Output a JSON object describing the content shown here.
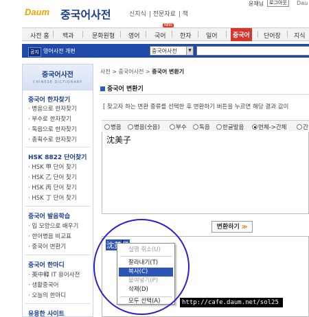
{
  "header": {
    "logo": "Daum",
    "service_title": "중국어사전",
    "sublinks": [
      "신지식",
      "전문자료",
      "책"
    ],
    "user": "윤재님",
    "logout": "로그아웃",
    "right_cut": "Dau"
  },
  "nav": {
    "tabs": [
      "사전 홈",
      "백과",
      "문화원형",
      "영어",
      "국어",
      "한자",
      "일어",
      "중국어",
      "단어장",
      "지식"
    ],
    "active": "중국어",
    "new_badge": "NEW"
  },
  "notice": {
    "badge": "공지",
    "text": "영어사전 개편",
    "search_select": "중국어사전",
    "search_value": ""
  },
  "sidebar": {
    "title": "중국어사전",
    "subtitle": "CHINESE DICTIONARY",
    "sections": [
      {
        "title": "중국어 한자찾기",
        "items": [
          "· 병음으로 한자찾기",
          "· 부수로 한자찾기",
          "· 독음으로 한자찾기",
          "· 총획수로 한자찾기"
        ]
      },
      {
        "title": "HSK 8822 단어찾기",
        "items": [
          "· HSK 甲 단어 찾기",
          "· HSK 乙 단어 찾기",
          "· HSK 丙 단어 찾기",
          "· HSK 丁 단어 찾기"
        ]
      },
      {
        "title": "중국어 발음학습",
        "items": [
          "· 입 모양으로 배우기",
          "· 한어병음 비교표",
          "· 중국어 변환기"
        ]
      },
      {
        "title": "중국어 한마디",
        "items": [
          "· 英中韓 IT 용어사전",
          "· 생활중국어",
          "· 오늘의 한마디"
        ]
      },
      {
        "title": "유용한 사이트",
        "items": []
      }
    ]
  },
  "main": {
    "breadcrumb_prefix": "사전 > 중국어사전 > ",
    "breadcrumb_current": "중국어 변환기",
    "title": "중국어 변환기",
    "instruction": "[ 찾고자 하는 변환 종류를 선택한 후 변환하기 버튼을 누르면 해당 결과 값이",
    "radio_options": [
      "병음",
      "병음(숫음)",
      "부수",
      "독음",
      "한글발음",
      "번체->간체",
      "간"
    ],
    "radio_selected_index": 5,
    "input_text": "沈美子",
    "convert_button": "변환하기",
    "output_text": "沈美子"
  },
  "context_menu": {
    "items": [
      {
        "label": "실행 취소(U)",
        "enabled": false
      },
      {
        "label": "잘라내기(T)",
        "enabled": true
      },
      {
        "label": "복사(C)",
        "enabled": true,
        "highlighted": true
      },
      {
        "label": "붙여넣기(P)",
        "enabled": false
      },
      {
        "label": "삭제(D)",
        "enabled": true
      },
      {
        "label": "모두 선택(A)",
        "enabled": true
      }
    ]
  },
  "watermark": "http://cafe.daum.net/sol25",
  "colors": {
    "brand_blue": "#1b3d8f",
    "notice_bar": "#1f4aa8",
    "active_tab": "#d8342c",
    "selection": "#2c55b5",
    "annotation_circle": "#2a1ed1"
  }
}
